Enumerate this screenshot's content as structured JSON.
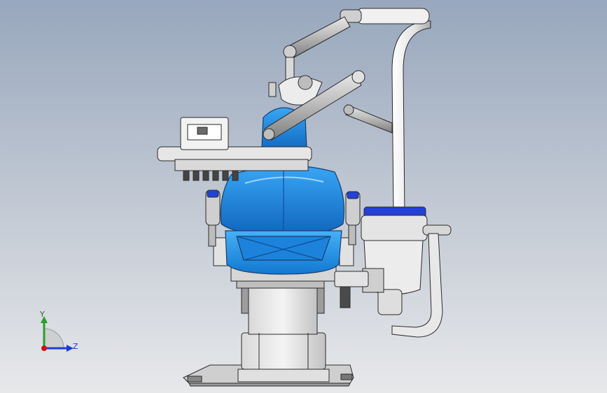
{
  "triad": {
    "y_label": "Y",
    "z_label": "Z",
    "colors": {
      "y": "#2aa02a",
      "z": "#1c3cd6",
      "origin": "#d01010"
    }
  },
  "model": {
    "colors": {
      "seat_blue": "#1f8fe6",
      "seat_blue_dark": "#0f5fae",
      "accent_blue": "#2340d8",
      "light_gray": "#e6e6e6",
      "mid_gray": "#a8a8a8",
      "dark_gray": "#555555",
      "edge": "#2b2b2b"
    }
  }
}
